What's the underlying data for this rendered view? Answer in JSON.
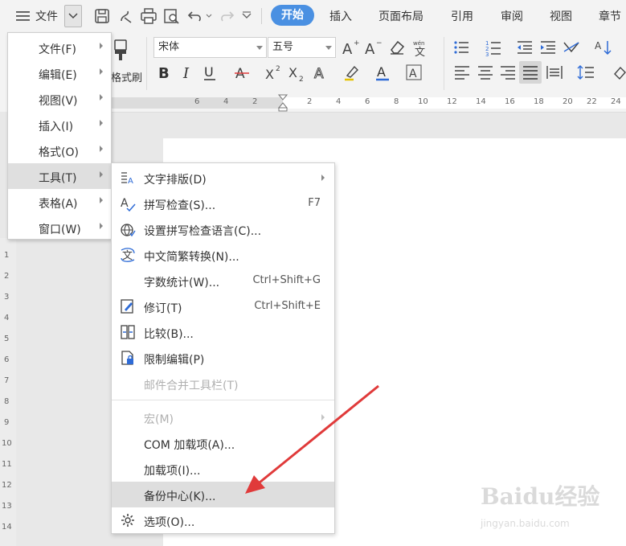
{
  "topbar": {
    "file_label": "文件",
    "tabs": [
      "开始",
      "插入",
      "页面布局",
      "引用",
      "审阅",
      "视图",
      "章节"
    ],
    "active_tab_color": "#4a90e2"
  },
  "ribbon": {
    "format_painter_label": "格式刷",
    "font_name": "宋体",
    "font_size": "五号"
  },
  "ruler": {
    "h_ticks": [
      "6",
      "4",
      "2",
      "2",
      "4",
      "6",
      "8",
      "10",
      "12",
      "14",
      "16",
      "18",
      "20",
      "22",
      "24"
    ],
    "v_ticks": [
      "1",
      "2",
      "3",
      "4",
      "5",
      "6",
      "7",
      "8",
      "9",
      "10",
      "11",
      "12",
      "13",
      "14"
    ]
  },
  "main_menu": {
    "items": [
      {
        "label": "文件(F)"
      },
      {
        "label": "编辑(E)"
      },
      {
        "label": "视图(V)"
      },
      {
        "label": "插入(I)"
      },
      {
        "label": "格式(O)"
      },
      {
        "label": "工具(T)"
      },
      {
        "label": "表格(A)"
      },
      {
        "label": "窗口(W)"
      }
    ]
  },
  "tools_menu": {
    "items": [
      {
        "label": "文字排版(D)",
        "shortcut": "",
        "icon": "text-layout-icon"
      },
      {
        "label": "拼写检查(S)...",
        "shortcut": "F7",
        "icon": "spell-check-icon"
      },
      {
        "label": "设置拼写检查语言(C)...",
        "shortcut": "",
        "icon": "globe-icon"
      },
      {
        "label": "中文简繁转换(N)...",
        "shortcut": "",
        "icon": "chinese-convert-icon"
      },
      {
        "label": "字数统计(W)...",
        "shortcut": "Ctrl+Shift+G",
        "icon": ""
      },
      {
        "label": "修订(T)",
        "shortcut": "Ctrl+Shift+E",
        "icon": "revision-icon"
      },
      {
        "label": "比较(B)...",
        "shortcut": "",
        "icon": "compare-icon"
      },
      {
        "label": "限制编辑(P)",
        "shortcut": "",
        "icon": "restrict-edit-icon"
      },
      {
        "label": "邮件合并工具栏(T)",
        "shortcut": "",
        "icon": ""
      },
      {
        "label": "宏(M)",
        "shortcut": "",
        "icon": ""
      },
      {
        "label": "COM 加载项(A)...",
        "shortcut": "",
        "icon": ""
      },
      {
        "label": "加载项(I)...",
        "shortcut": "",
        "icon": ""
      },
      {
        "label": "备份中心(K)...",
        "shortcut": "",
        "icon": ""
      },
      {
        "label": "选项(O)...",
        "shortcut": "",
        "icon": "gear-icon"
      }
    ]
  },
  "watermark": {
    "brand": "Baidu经验",
    "url": "jingyan.baidu.com"
  },
  "annotation_color": "#e03a3a"
}
